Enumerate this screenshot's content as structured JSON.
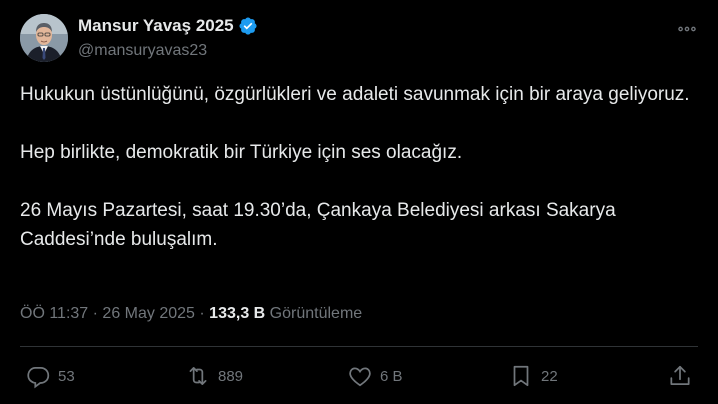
{
  "author": {
    "display_name": "Mansur Yavaş 2025",
    "handle": "@mansuryavas23",
    "verified_badge_color": "#1d9bf0"
  },
  "tweet": {
    "paragraphs": [
      "Hukukun üstünlüğünü, özgürlükleri ve adaleti savunmak için bir araya geliyoruz.",
      "Hep birlikte, demokratik bir Türkiye için ses olacağız.",
      "26 Mayıs Pazartesi, saat 19.30’da, Çankaya Belediyesi arkası Sakarya Caddesi’nde buluşalım."
    ]
  },
  "meta": {
    "time": "ÖÖ 11:37",
    "separator": "·",
    "date": "26 May 2025",
    "views_count": "133,3 B",
    "views_label": "Görüntüleme"
  },
  "actions": {
    "reply_count": "53",
    "repost_count": "889",
    "like_count": "6 B",
    "bookmark_count": "22"
  },
  "icons": {
    "more": "more-horizontal-icon",
    "reply": "reply-icon",
    "repost": "repost-icon",
    "like": "heart-icon",
    "bookmark": "bookmark-icon",
    "share": "share-icon",
    "verified": "verified-badge-icon"
  },
  "colors": {
    "background": "#000000",
    "primary_text": "#e7e9ea",
    "secondary_text": "#71767b",
    "divider": "#2f3336"
  }
}
